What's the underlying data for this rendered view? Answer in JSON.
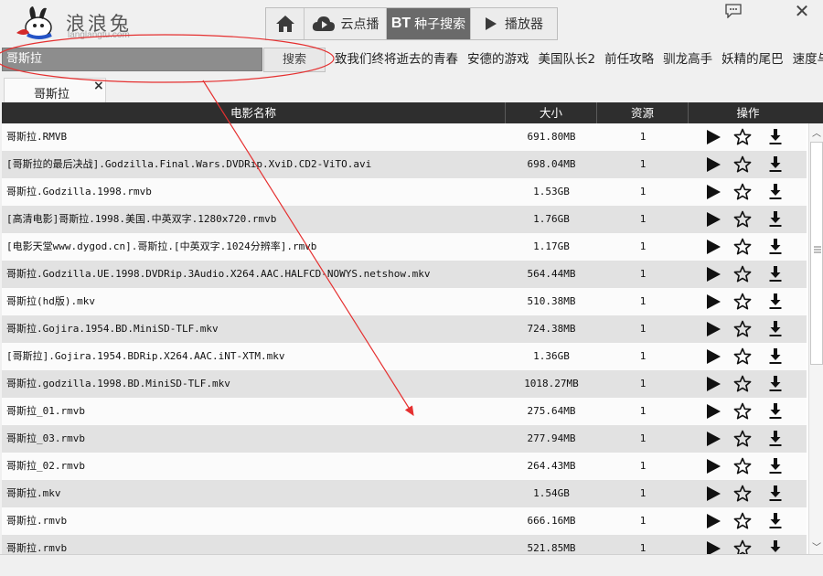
{
  "app": {
    "name": "浪浪兔",
    "domain": "langlangtu.com"
  },
  "nav": {
    "home_icon": "home-icon",
    "cloud_label": "云点播",
    "bt_prefix": "BT",
    "bt_label": "种子搜索",
    "player_label": "播放器"
  },
  "window": {
    "close": "✕"
  },
  "search": {
    "value": "哥斯拉",
    "button_label": "搜索"
  },
  "hot_keywords": [
    "致我们终将逝去的青春",
    "安德的游戏",
    "美国队长2",
    "前任攻略",
    "驯龙高手",
    "妖精的尾巴",
    "速度与激情"
  ],
  "tabs": [
    {
      "label": "哥斯拉",
      "close": "×"
    }
  ],
  "table": {
    "headers": {
      "name": "电影名称",
      "size": "大小",
      "sources": "资源",
      "actions": "操作"
    },
    "rows": [
      {
        "name": "哥斯拉.RMVB",
        "size": "691.80MB",
        "sources": "1"
      },
      {
        "name": "[哥斯拉的最后决战].Godzilla.Final.Wars.DVDRip.XviD.CD2-ViTO.avi",
        "size": "698.04MB",
        "sources": "1"
      },
      {
        "name": "哥斯拉.Godzilla.1998.rmvb",
        "size": "1.53GB",
        "sources": "1"
      },
      {
        "name": "[高清电影]哥斯拉.1998.美国.中英双字.1280x720.rmvb",
        "size": "1.76GB",
        "sources": "1"
      },
      {
        "name": "[电影天堂www.dygod.cn].哥斯拉.[中英双字.1024分辨率].rmvb",
        "size": "1.17GB",
        "sources": "1"
      },
      {
        "name": "哥斯拉.Godzilla.UE.1998.DVDRip.3Audio.X264.AAC.HALFCD-NOWYS.netshow.mkv",
        "size": "564.44MB",
        "sources": "1"
      },
      {
        "name": "哥斯拉(hd版).mkv",
        "size": "510.38MB",
        "sources": "1"
      },
      {
        "name": "哥斯拉.Gojira.1954.BD.MiniSD-TLF.mkv",
        "size": "724.38MB",
        "sources": "1"
      },
      {
        "name": "[哥斯拉].Gojira.1954.BDRip.X264.AAC.iNT-XTM.mkv",
        "size": "1.36GB",
        "sources": "1"
      },
      {
        "name": "哥斯拉.godzilla.1998.BD.MiniSD-TLF.mkv",
        "size": "1018.27MB",
        "sources": "1"
      },
      {
        "name": "哥斯拉_01.rmvb",
        "size": "275.64MB",
        "sources": "1"
      },
      {
        "name": "哥斯拉_03.rmvb",
        "size": "277.94MB",
        "sources": "1"
      },
      {
        "name": "哥斯拉_02.rmvb",
        "size": "264.43MB",
        "sources": "1"
      },
      {
        "name": "哥斯拉.mkv",
        "size": "1.54GB",
        "sources": "1"
      },
      {
        "name": "哥斯拉.rmvb",
        "size": "666.16MB",
        "sources": "1"
      },
      {
        "name": "哥斯拉.rmvb",
        "size": "521.85MB",
        "sources": "1"
      }
    ]
  },
  "annotation": {
    "color": "#e53030"
  }
}
